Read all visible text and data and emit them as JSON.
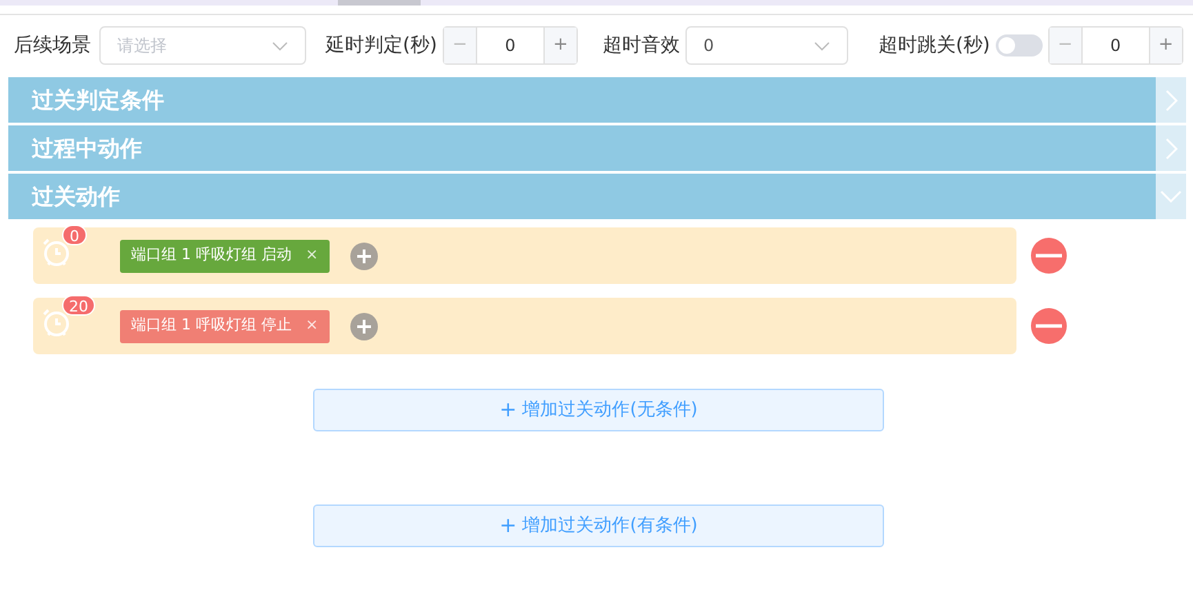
{
  "toolbar": {
    "next_scene": {
      "label": "后续场景",
      "placeholder": "请选择"
    },
    "delay": {
      "label": "延时判定(秒)",
      "value": "0",
      "minus": "−",
      "plus": "+"
    },
    "timeout_sound": {
      "label": "超时音效",
      "value": "0"
    },
    "timeout_skip": {
      "label": "超时跳关(秒)",
      "on": false,
      "value": "0",
      "minus": "−",
      "plus": "+"
    }
  },
  "sections": [
    {
      "title": "过关判定条件",
      "expanded": false
    },
    {
      "title": "过程中动作",
      "expanded": false
    },
    {
      "title": "过关动作",
      "expanded": true
    }
  ],
  "actions": [
    {
      "delay": "0",
      "tag": {
        "text": "端口组 1 呼吸灯组 启动",
        "color": "#67a83d",
        "remove": "×"
      }
    },
    {
      "delay": "20",
      "tag": {
        "text": "端口组 1 呼吸灯组 停止",
        "color": "#f07f74",
        "remove": "×"
      }
    }
  ],
  "buttons": [
    {
      "icon": "+",
      "label": "增加过关动作(无条件)"
    },
    {
      "icon": "+",
      "label": "增加过关动作(有条件)"
    }
  ]
}
